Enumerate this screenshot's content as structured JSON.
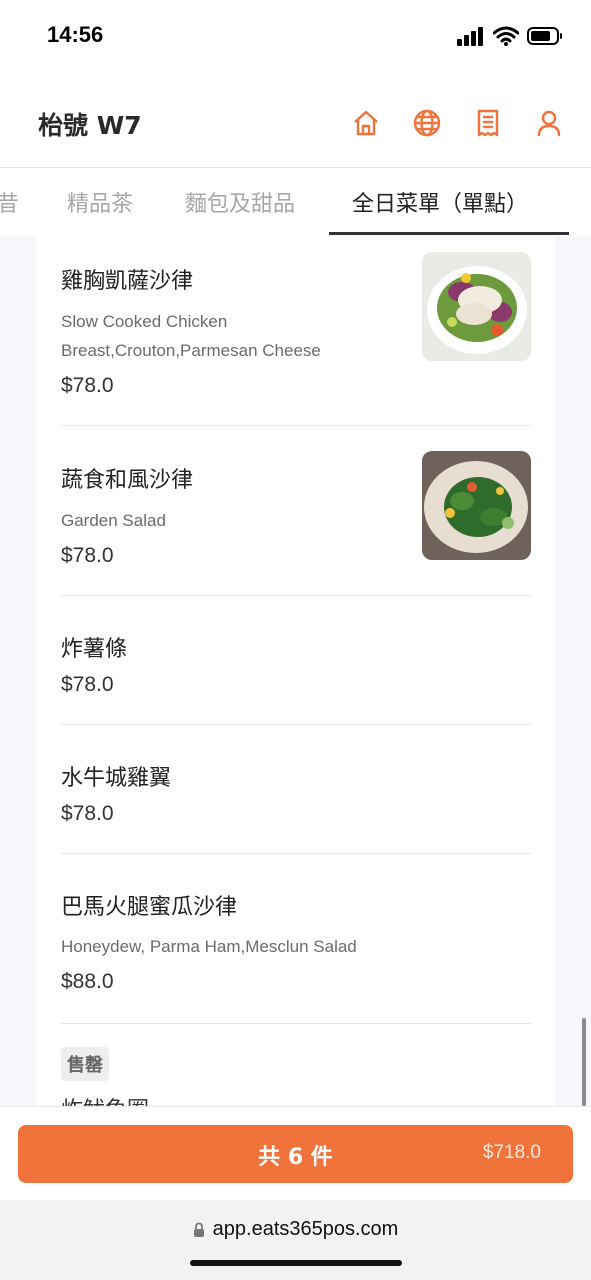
{
  "status_bar": {
    "time": "14:56"
  },
  "header": {
    "table_title": "枱號 W7",
    "icons": [
      "home-icon",
      "globe-icon",
      "receipt-icon",
      "user-icon"
    ],
    "accent_color": "#f0733c"
  },
  "tabs": [
    {
      "label": "昔",
      "active": false
    },
    {
      "label": "精品茶",
      "active": false
    },
    {
      "label": "麵包及甜品",
      "active": false
    },
    {
      "label": "全日菜單（單點）",
      "active": true
    }
  ],
  "menu_items": [
    {
      "name": "雞胸凱薩沙律",
      "desc_line1": "Slow Cooked Chicken",
      "desc_line2": "Breast,Crouton,Parmesan Cheese",
      "price": "$78.0",
      "has_photo": true
    },
    {
      "name": "蔬食和風沙律",
      "desc_line1": "Garden Salad",
      "price": "$78.0",
      "has_photo": true
    },
    {
      "name": "炸薯條",
      "price": "$78.0",
      "has_photo": false
    },
    {
      "name": "水牛城雞翼",
      "price": "$78.0",
      "has_photo": false
    },
    {
      "name": "巴馬火腿蜜瓜沙律",
      "desc_line1": "Honeydew, Parma Ham,Mesclun Salad",
      "price": "$88.0",
      "has_photo": false
    }
  ],
  "sold_out_item": {
    "badge": "售罄",
    "name": "炸魷魚圈"
  },
  "cart": {
    "count_label": "共 6 件",
    "total": "$718.0"
  },
  "browser": {
    "url": "app.eats365pos.com"
  }
}
